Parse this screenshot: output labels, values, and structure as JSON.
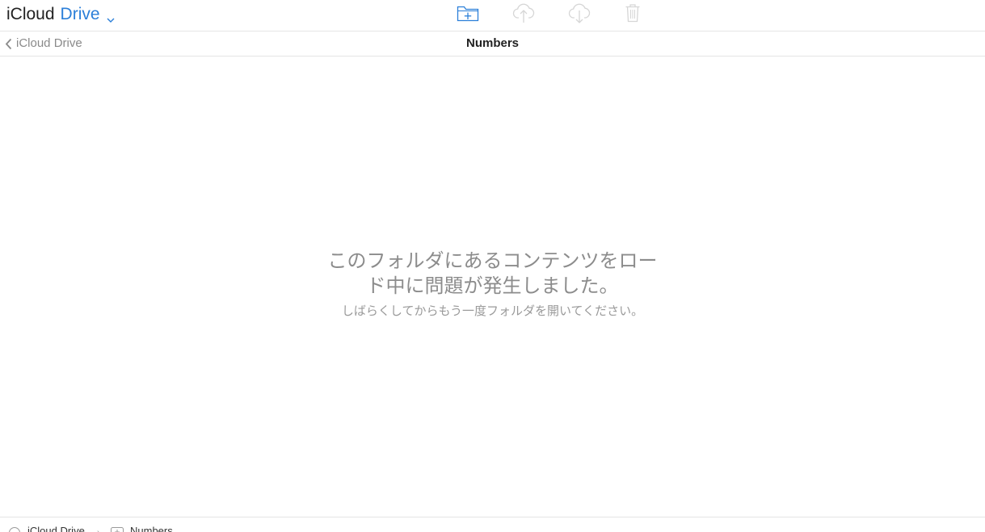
{
  "header": {
    "brand": "iCloud",
    "product": "Drive",
    "toolbar": {
      "new_folder_icon": "folder-plus-icon",
      "upload_icon": "cloud-upload-icon",
      "download_icon": "cloud-download-icon",
      "delete_icon": "trash-icon"
    }
  },
  "subheader": {
    "back_label": "iCloud Drive",
    "folder_title": "Numbers"
  },
  "main": {
    "error_title": "このフォルダにあるコンテンツをロード中に問題が発生しました。",
    "error_subtitle": "しばらくしてからもう一度フォルダを開いてください。"
  },
  "footer": {
    "path": [
      {
        "label": "iCloud Drive",
        "icon": "cloud-icon"
      },
      {
        "label": "Numbers",
        "icon": "folder-icon"
      }
    ]
  },
  "colors": {
    "accent": "#2b7fd9",
    "toolbar_active": "#2b7fd9",
    "toolbar_disabled": "#d6d6d6",
    "error_text": "#8c8c8c"
  }
}
